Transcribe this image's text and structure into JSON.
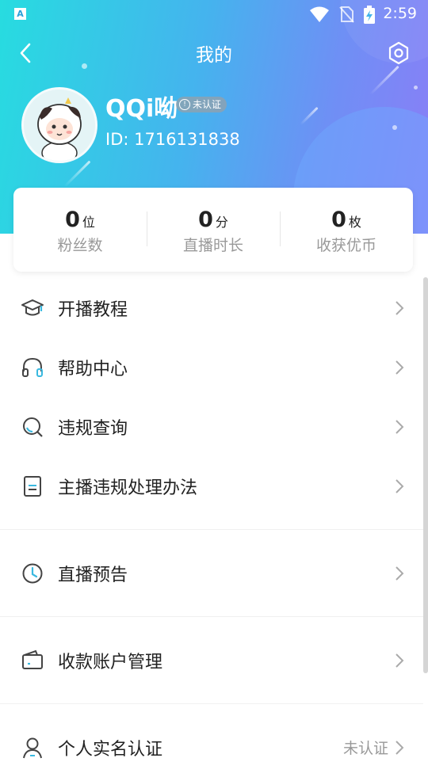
{
  "status_bar": {
    "app_badge": "A",
    "time": "2:59"
  },
  "header": {
    "title": "我的"
  },
  "profile": {
    "name": "QQi呦",
    "badge": "未认证",
    "id_text": "ID: 1716131838"
  },
  "stats": [
    {
      "value": "0",
      "unit": "位",
      "label": "粉丝数"
    },
    {
      "value": "0",
      "unit": "分",
      "label": "直播时长"
    },
    {
      "value": "0",
      "unit": "枚",
      "label": "收获优币"
    }
  ],
  "menu": [
    {
      "label": "开播教程",
      "icon": "graduation-cap-icon"
    },
    {
      "label": "帮助中心",
      "icon": "headphones-icon"
    },
    {
      "label": "违规查询",
      "icon": "search-icon"
    },
    {
      "label": "主播违规处理办法",
      "icon": "document-icon"
    },
    {
      "label": "直播预告",
      "icon": "clock-icon"
    },
    {
      "label": "收款账户管理",
      "icon": "wallet-icon"
    },
    {
      "label": "个人实名认证",
      "icon": "user-icon",
      "status": "未认证"
    }
  ],
  "colors": {
    "accent": "#3bc3e6",
    "icon_highlight": "#3ab9e0"
  }
}
